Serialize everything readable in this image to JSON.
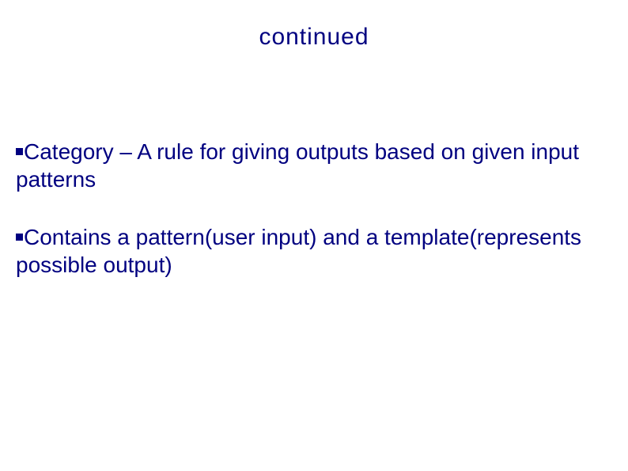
{
  "title": "continued",
  "bullets": [
    "Category – A rule for giving outputs based on given input patterns",
    "Contains a pattern(user input) and a template(represents possible output)"
  ]
}
